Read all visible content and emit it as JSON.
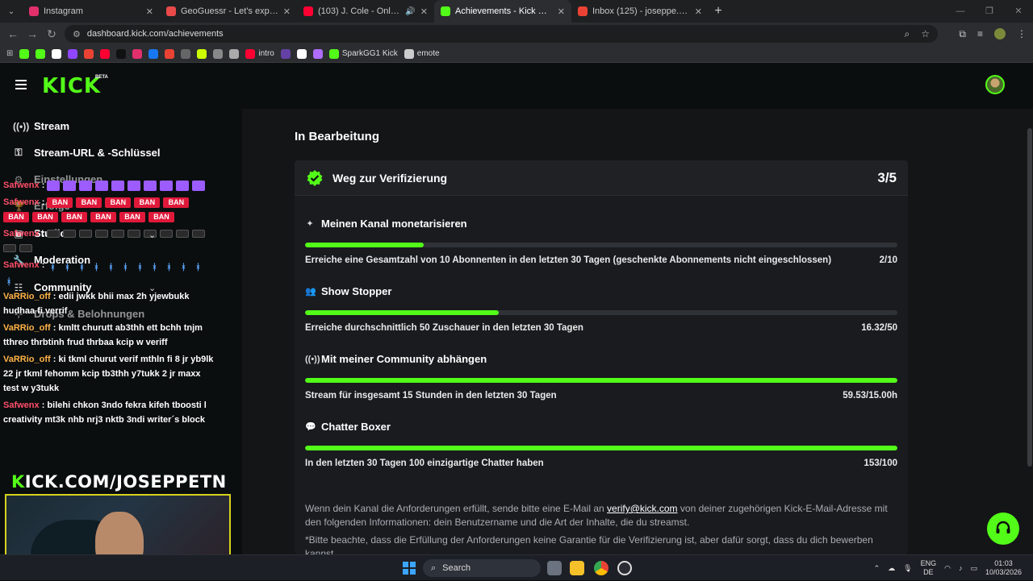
{
  "browser": {
    "tabs": [
      {
        "title": "Instagram",
        "color": "#e1306c",
        "active": false,
        "audio": false
      },
      {
        "title": "GeoGuessr - Let's explore the w",
        "color": "#e84a4a",
        "active": false,
        "audio": false
      },
      {
        "title": "(103) J. Cole - Only You (Offi",
        "color": "#ff0033",
        "active": false,
        "audio": true
      },
      {
        "title": "Achievements - Kick Dashboard",
        "color": "#53fc18",
        "active": true,
        "audio": false
      },
      {
        "title": "Inbox (125) - joseppe.tn@gmai",
        "color": "#ea4335",
        "active": false,
        "audio": false
      }
    ],
    "url": "dashboard.kick.com/achievements",
    "bookmarks": [
      {
        "label": "",
        "color": "#53fc18"
      },
      {
        "label": "",
        "color": "#53fc18"
      },
      {
        "label": "",
        "color": "#ffffff"
      },
      {
        "label": "",
        "color": "#9146ff"
      },
      {
        "label": "",
        "color": "#ea4335"
      },
      {
        "label": "",
        "color": "#ff0033"
      },
      {
        "label": "",
        "color": "#111111"
      },
      {
        "label": "",
        "color": "#e1306c"
      },
      {
        "label": "",
        "color": "#1877f2"
      },
      {
        "label": "",
        "color": "#ea4335"
      },
      {
        "label": "",
        "color": "#666666"
      },
      {
        "label": "",
        "color": "#ccff00"
      },
      {
        "label": "",
        "color": "#888888"
      },
      {
        "label": "",
        "color": "#aaaaaa"
      },
      {
        "label": "intro",
        "color": "#ff0033"
      },
      {
        "label": "",
        "color": "#6441a5"
      },
      {
        "label": "",
        "color": "#ffffff"
      },
      {
        "label": "",
        "color": "#b06cff"
      },
      {
        "label": "SparkGG1 Kick",
        "color": "#53fc18"
      },
      {
        "label": "emote",
        "color": "#cccccc"
      }
    ]
  },
  "kick": {
    "logo": "KICK",
    "beta": "BETA",
    "accent": "#53fc18"
  },
  "sidebar": {
    "items": [
      {
        "label": "Stream",
        "icon": "broadcast-icon"
      },
      {
        "label": "Stream-URL & -Schlüssel",
        "icon": "key-icon"
      },
      {
        "label": "Einstellungen",
        "icon": "settings-icon"
      },
      {
        "label": "Erfolge",
        "icon": "trophy-icon"
      },
      {
        "label": "Studio",
        "icon": "studio-icon"
      },
      {
        "label": "Moderation",
        "icon": "wrench-icon"
      },
      {
        "label": "Community",
        "icon": "community-icon"
      },
      {
        "label": "Drops & Belohnungen",
        "icon": "gift-icon"
      }
    ]
  },
  "chat": [
    {
      "user": "Safwenx",
      "text": ""
    },
    {
      "user": "Safwenx",
      "text": ""
    },
    {
      "user": "Safwenx",
      "text": ""
    },
    {
      "user": "Safwenx",
      "text": ""
    },
    {
      "user": "VaRRio_off",
      "text": "edii jwkk bhii max 2h yjewbukk hudhaa fi verrif"
    },
    {
      "user": "VaRRio_off",
      "text": "kmltt churutt ab3thh ett bchh tnjm tthreo thrbtinh frud thrbaa kcip w veriff"
    },
    {
      "user": "VaRRio_off",
      "text": "ki tkml churut verif mthln fi 8 jr yb9lk 22 jr tkml fehomm kcip tb3thh y7tukk 2 jr maxx test w y3tukk"
    },
    {
      "user": "Safwenx",
      "text": "bilehi chkon 3ndo fekra kifeh tboosti l creativity mt3k nhb nrj3 nktb 3ndi writer´s block"
    }
  ],
  "emotes": {
    "ban": "BAN"
  },
  "camera": {
    "banner_prefix": "K",
    "banner_rest": "ICK.COM/JOSEPPETN"
  },
  "main": {
    "section_title": "In Bearbeitung",
    "card": {
      "title": "Weg zur Verifizierung",
      "count": "3/5",
      "requirements": [
        {
          "title": "Meinen Kanal monetarisieren",
          "icon": "sparkle-icon",
          "description": "Erreiche eine Gesamtzahl von 10 Abonnenten in den letzten 30 Tagen (geschenkte Abonnements nicht eingeschlossen)",
          "value": "2/10",
          "progress": 0.2
        },
        {
          "title": "Show Stopper",
          "icon": "viewers-icon",
          "description": "Erreiche durchschnittlich 50 Zuschauer in den letzten 30 Tagen",
          "value": "16.32/50",
          "progress": 0.3264
        },
        {
          "title": "Mit meiner Community abhängen",
          "icon": "broadcast-icon",
          "description": "Stream für insgesamt 15 Stunden in den letzten 30 Tagen",
          "value": "59.53/15.00h",
          "progress": 1.0
        },
        {
          "title": "Chatter Boxer",
          "icon": "chat-icon",
          "description": "In den letzten 30 Tagen 100 einzigartige Chatter haben",
          "value": "153/100",
          "progress": 1.0
        }
      ],
      "note_before": "Wenn dein Kanal die Anforderungen erfüllt, sende bitte eine E-Mail an ",
      "note_email": "verify@kick.com",
      "note_after": " von deiner zugehörigen Kick-E-Mail-Adresse mit den folgenden Informationen: dein Benutzername und die Art der Inhalte, die du streamst.",
      "disclaimer": "*Bitte beachte, dass die Erfüllung der Anforderungen keine Garantie für die Verifizierung ist, aber dafür sorgt, dass du dich bewerben kannst."
    }
  },
  "taskbar": {
    "search": "Search",
    "lang_top": "ENG",
    "lang_bottom": "DE",
    "time": "01:03",
    "date": "10/03/2026"
  }
}
